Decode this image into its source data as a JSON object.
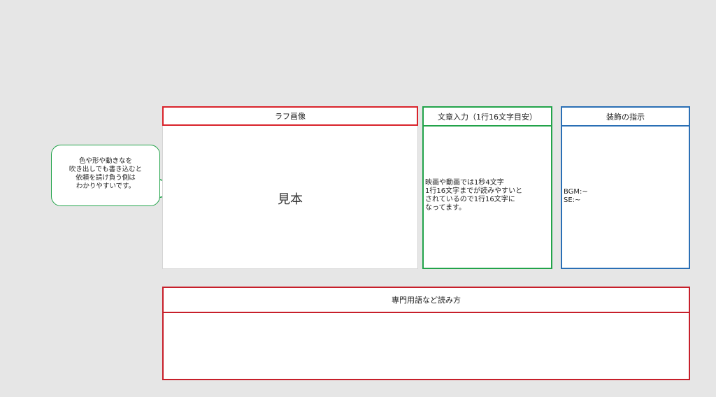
{
  "panels": {
    "rough": {
      "title": "ラフ画像",
      "sample": "見本"
    },
    "text": {
      "title": "文章入力（1行16文字目安）",
      "body": "映画や動画では1秒4文字\n1行16文字までが読みやすいと\nされているので1行16文字に\nなってます。"
    },
    "decoration": {
      "title": "装飾の指示",
      "bgm": "BGM:~",
      "se": "SE:~"
    },
    "terms": {
      "title": "専門用語など読み方"
    }
  },
  "bubble": {
    "text": "色や形や動きなを\n吹き出しでも書き込むと\n依頼を請け負う側は\nわかりやすいです。"
  },
  "colors": {
    "background": "#e6e6e6",
    "red": "#d9232b",
    "green": "#22a34a",
    "blue": "#2a6fb5"
  }
}
